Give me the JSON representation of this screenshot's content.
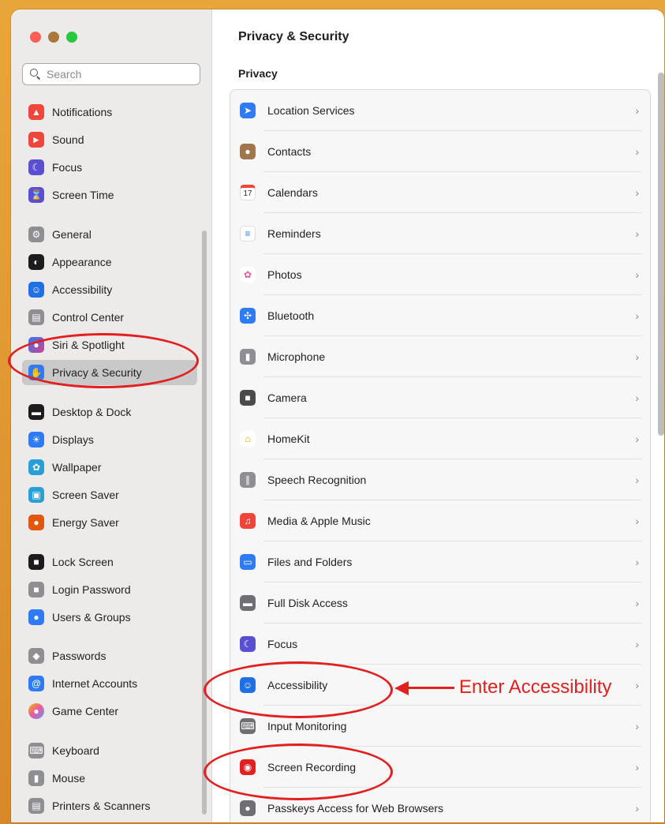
{
  "sidebar": {
    "search_placeholder": "Search",
    "items": [
      {
        "label": "Notifications",
        "icon": "bell-icon",
        "color": "#f0453a"
      },
      {
        "label": "Sound",
        "icon": "speaker-icon",
        "color": "#f0453a"
      },
      {
        "label": "Focus",
        "icon": "moon-icon",
        "color": "#5a4fd1"
      },
      {
        "label": "Screen Time",
        "icon": "hourglass-icon",
        "color": "#5a4fd1"
      },
      {
        "label": "General",
        "icon": "gear-icon",
        "color": "#8e8e93"
      },
      {
        "label": "Appearance",
        "icon": "appearance-icon",
        "color": "#1c1c1e"
      },
      {
        "label": "Accessibility",
        "icon": "accessibility-icon",
        "color": "#1f6fe5"
      },
      {
        "label": "Control Center",
        "icon": "toggles-icon",
        "color": "#8e8e93"
      },
      {
        "label": "Siri & Spotlight",
        "icon": "siri-icon",
        "color": "#6a3fb8"
      },
      {
        "label": "Privacy & Security",
        "icon": "hand-icon",
        "color": "#2f7bf6"
      },
      {
        "label": "Desktop & Dock",
        "icon": "dock-icon",
        "color": "#1c1c1e"
      },
      {
        "label": "Displays",
        "icon": "sun-icon",
        "color": "#2f7bf6"
      },
      {
        "label": "Wallpaper",
        "icon": "flower-icon",
        "color": "#2a9fd6"
      },
      {
        "label": "Screen Saver",
        "icon": "screensaver-icon",
        "color": "#2a9fd6"
      },
      {
        "label": "Energy Saver",
        "icon": "bulb-icon",
        "color": "#e2570e"
      },
      {
        "label": "Lock Screen",
        "icon": "lock-icon",
        "color": "#1c1c1e"
      },
      {
        "label": "Login Password",
        "icon": "padlock-icon",
        "color": "#8e8e93"
      },
      {
        "label": "Users & Groups",
        "icon": "users-icon",
        "color": "#2f7bf6"
      },
      {
        "label": "Passwords",
        "icon": "key-icon",
        "color": "#8e8e93"
      },
      {
        "label": "Internet Accounts",
        "icon": "at-icon",
        "color": "#2f7bf6"
      },
      {
        "label": "Game Center",
        "icon": "gamecenter-icon",
        "color": "#e95aa0"
      },
      {
        "label": "Keyboard",
        "icon": "keyboard-icon",
        "color": "#8e8e93"
      },
      {
        "label": "Mouse",
        "icon": "mouse-icon",
        "color": "#8e8e93"
      },
      {
        "label": "Printers & Scanners",
        "icon": "printer-icon",
        "color": "#8e8e93"
      }
    ]
  },
  "main": {
    "title": "Privacy & Security",
    "section": "Privacy",
    "rows": [
      {
        "label": "Location Services",
        "icon": "location-arrow-icon",
        "color": "#2f7bf6"
      },
      {
        "label": "Contacts",
        "icon": "contacts-icon",
        "color": "#a0764e"
      },
      {
        "label": "Calendars",
        "icon": "calendar-icon",
        "color": "#ffffff",
        "calendar_day": "17"
      },
      {
        "label": "Reminders",
        "icon": "reminders-icon",
        "color": "#ffffff"
      },
      {
        "label": "Photos",
        "icon": "photos-icon",
        "color": "#ffffff"
      },
      {
        "label": "Bluetooth",
        "icon": "bluetooth-icon",
        "color": "#2f7bf6"
      },
      {
        "label": "Microphone",
        "icon": "microphone-icon",
        "color": "#8e8e93"
      },
      {
        "label": "Camera",
        "icon": "camera-icon",
        "color": "#4a4a4a"
      },
      {
        "label": "HomeKit",
        "icon": "home-icon",
        "color": "#ffffff"
      },
      {
        "label": "Speech Recognition",
        "icon": "waveform-icon",
        "color": "#8e8e93"
      },
      {
        "label": "Media & Apple Music",
        "icon": "music-icon",
        "color": "#f0453a"
      },
      {
        "label": "Files and Folders",
        "icon": "folder-icon",
        "color": "#2f7bf6"
      },
      {
        "label": "Full Disk Access",
        "icon": "disk-icon",
        "color": "#6e6e73"
      },
      {
        "label": "Focus",
        "icon": "moon-icon",
        "color": "#5a4fd1"
      },
      {
        "label": "Accessibility",
        "icon": "accessibility-icon",
        "color": "#1f6fe5"
      },
      {
        "label": "Input Monitoring",
        "icon": "keyboard-icon",
        "color": "#6e6e73"
      },
      {
        "label": "Screen Recording",
        "icon": "record-icon",
        "color": "#e22020"
      },
      {
        "label": "Passkeys Access for Web Browsers",
        "icon": "passkey-icon",
        "color": "#6e6e73"
      }
    ],
    "chevron": "›"
  },
  "annotation": {
    "text": "Enter Accessibility",
    "color": "#e22020"
  }
}
